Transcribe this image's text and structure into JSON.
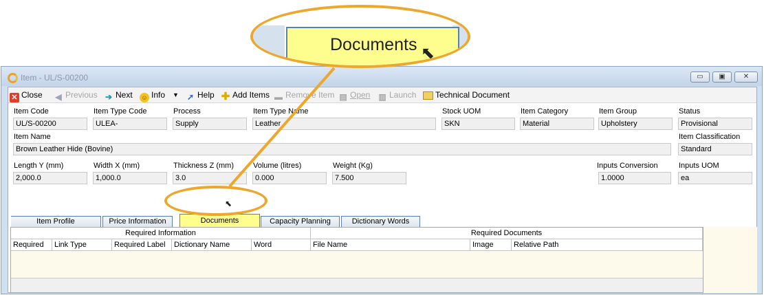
{
  "window": {
    "title": "Item - UL/S-00200",
    "minimize_glyph": "▭",
    "restore_glyph": "▣",
    "close_glyph": "✕"
  },
  "toolbar": {
    "close": "Close",
    "previous": "Previous",
    "next": "Next",
    "info": "Info",
    "help": "Help",
    "add_items": "Add Items",
    "remove_item": "Remove Item",
    "open": "Open",
    "launch": "Launch",
    "technical_document": "Technical Document"
  },
  "form": {
    "item_code": {
      "label": "Item Code",
      "value": "UL/S-00200"
    },
    "item_type_code": {
      "label": "Item Type Code",
      "value": "ULEA-"
    },
    "process": {
      "label": "Process",
      "value": "Supply"
    },
    "item_type_name": {
      "label": "Item Type Name",
      "value": "Leather"
    },
    "stock_uom": {
      "label": "Stock UOM",
      "value": "SKN"
    },
    "item_category": {
      "label": "Item Category",
      "value": "Material"
    },
    "item_group": {
      "label": "Item Group",
      "value": "Upholstery"
    },
    "status": {
      "label": "Status",
      "value": "Provisional"
    },
    "item_name": {
      "label": "Item Name",
      "value": "Brown Leather Hide (Bovine)"
    },
    "item_classification": {
      "label": "Item Classification",
      "value": "Standard"
    },
    "length_y": {
      "label": "Length Y (mm)",
      "value": "2,000.0"
    },
    "width_x": {
      "label": "Width X (mm)",
      "value": "1,000.0"
    },
    "thickness_z": {
      "label": "Thickness Z (mm)",
      "value": "3.0"
    },
    "volume": {
      "label": "Volume (litres)",
      "value": "0.000"
    },
    "weight": {
      "label": "Weight (Kg)",
      "value": "7.500"
    },
    "inputs_conversion": {
      "label": "Inputs Conversion",
      "value": "1.0000"
    },
    "inputs_uom": {
      "label": "Inputs UOM",
      "value": "ea"
    }
  },
  "tabs": [
    {
      "label": "Item Profile"
    },
    {
      "label": "Price Information"
    },
    {
      "label": "Documents"
    },
    {
      "label": "Capacity Planning"
    },
    {
      "label": "Dictionary Words"
    }
  ],
  "grid": {
    "group_required_info": "Required Information",
    "group_required_docs": "Required Documents",
    "columns": [
      "Required",
      "Link Type",
      "Required Label",
      "Dictionary Name",
      "Word",
      "File Name",
      "Image",
      "Relative Path"
    ]
  },
  "callout": {
    "zoom_label": "Documents",
    "accent": "#eca72c"
  },
  "colors": {
    "active_tab": "#fefe8f",
    "grid_background": "#fefaeb",
    "tab_border": "#5a7fb4"
  }
}
